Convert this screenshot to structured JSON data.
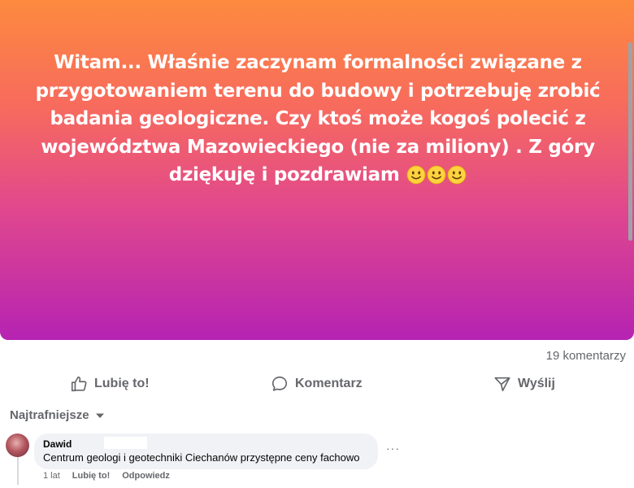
{
  "post": {
    "text": "Witam... Właśnie zaczynam formalności związane z przygotowaniem terenu do budowy i potrzebuję zrobić badania geologiczne. Czy ktoś może kogoś polecić z województwa Mazowieckiego (nie za miliony) . Z góry dziękuję i pozdrawiam",
    "emojis": [
      "slightly-smiling-face",
      "slightly-smiling-face",
      "slightly-smiling-face"
    ],
    "gradient_colors": [
      "#fd8a3e",
      "#f76a5e",
      "#e0478e",
      "#b523b2"
    ]
  },
  "stats": {
    "comment_count": "19 komentarzy"
  },
  "actions": {
    "like_label": "Lubię to!",
    "comment_label": "Komentarz",
    "share_label": "Wyślij"
  },
  "sort": {
    "label": "Najtrafniejsze"
  },
  "comments": [
    {
      "author": "Dawid",
      "text": "Centrum geologi i geotechniki Ciechanów przystępne ceny fachowo",
      "time": "1 lat",
      "like_label": "Lubię to!",
      "reply_label": "Odpowiedz",
      "more_label": "···"
    }
  ],
  "colors": {
    "secondary_text": "#65676b",
    "primary_text": "#050505",
    "bubble_bg": "#f0f2f5"
  }
}
